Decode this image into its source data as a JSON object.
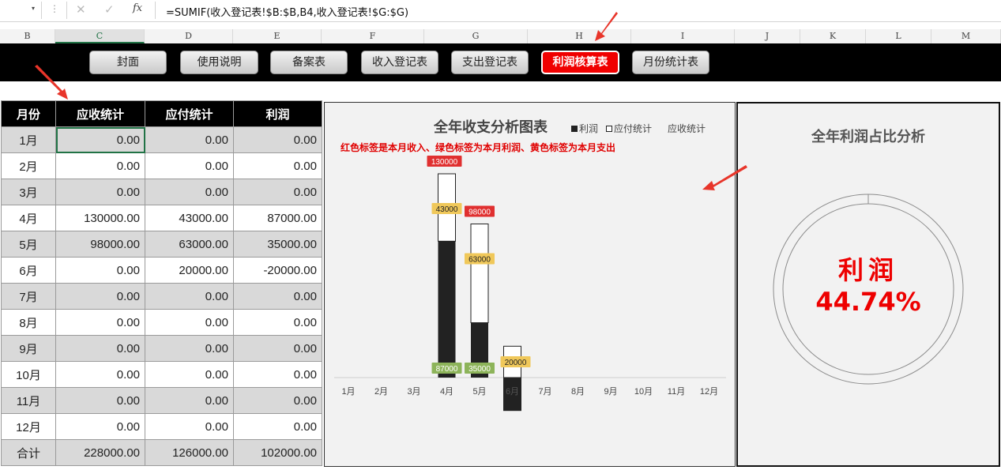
{
  "formula_bar": {
    "name_dropdown": "▾",
    "dots": "⋮",
    "cancel": "✕",
    "enter": "✓",
    "fx": "fx",
    "formula": "=SUMIF(收入登记表!$B:$B,B4,收入登记表!$G:$G)"
  },
  "columns": [
    "B",
    "C",
    "D",
    "E",
    "F",
    "G",
    "H",
    "I",
    "J",
    "K",
    "L",
    "M"
  ],
  "nav": {
    "buttons": [
      "封面",
      "使用说明",
      "备案表",
      "收入登记表",
      "支出登记表",
      "利润核算表",
      "月份统计表"
    ],
    "active": "利润核算表"
  },
  "table": {
    "headers": [
      "月份",
      "应收统计",
      "应付统计",
      "利润"
    ],
    "rows": [
      [
        "1月",
        "0.00",
        "0.00",
        "0.00"
      ],
      [
        "2月",
        "0.00",
        "0.00",
        "0.00"
      ],
      [
        "3月",
        "0.00",
        "0.00",
        "0.00"
      ],
      [
        "4月",
        "130000.00",
        "43000.00",
        "87000.00"
      ],
      [
        "5月",
        "98000.00",
        "63000.00",
        "35000.00"
      ],
      [
        "6月",
        "0.00",
        "20000.00",
        "-20000.00"
      ],
      [
        "7月",
        "0.00",
        "0.00",
        "0.00"
      ],
      [
        "8月",
        "0.00",
        "0.00",
        "0.00"
      ],
      [
        "9月",
        "0.00",
        "0.00",
        "0.00"
      ],
      [
        "10月",
        "0.00",
        "0.00",
        "0.00"
      ],
      [
        "11月",
        "0.00",
        "0.00",
        "0.00"
      ],
      [
        "12月",
        "0.00",
        "0.00",
        "0.00"
      ]
    ],
    "total": [
      "合计",
      "228000.00",
      "126000.00",
      "102000.00"
    ]
  },
  "chart": {
    "title": "全年收支分析图表",
    "legend": [
      "利润",
      "应付统计",
      "应收统计"
    ],
    "note": "红色标签是本月收入、绿色标签为本月利润、黄色标签为本月支出",
    "colors": {
      "profit": "#222222",
      "payable": "#ffffff",
      "receivable_label": "#e03030",
      "payable_label": "#f0c85a",
      "profit_label": "#8db45a"
    }
  },
  "chart_data": {
    "type": "bar",
    "categories": [
      "1月",
      "2月",
      "3月",
      "4月",
      "5月",
      "6月",
      "7月",
      "8月",
      "9月",
      "10月",
      "11月",
      "12月"
    ],
    "series": [
      {
        "name": "利润",
        "values": [
          0,
          0,
          0,
          87000,
          35000,
          -20000,
          0,
          0,
          0,
          0,
          0,
          0
        ]
      },
      {
        "name": "应付统计",
        "values": [
          0,
          0,
          0,
          43000,
          63000,
          20000,
          0,
          0,
          0,
          0,
          0,
          0
        ]
      },
      {
        "name": "应收统计",
        "values": [
          0,
          0,
          0,
          130000,
          98000,
          0,
          0,
          0,
          0,
          0,
          0,
          0
        ]
      }
    ],
    "ylim": [
      -20000,
      130000
    ],
    "stacked": true
  },
  "donut": {
    "title": "全年利润占比分析",
    "label": "利润",
    "value": "44.74%",
    "fraction": 0.4474
  }
}
